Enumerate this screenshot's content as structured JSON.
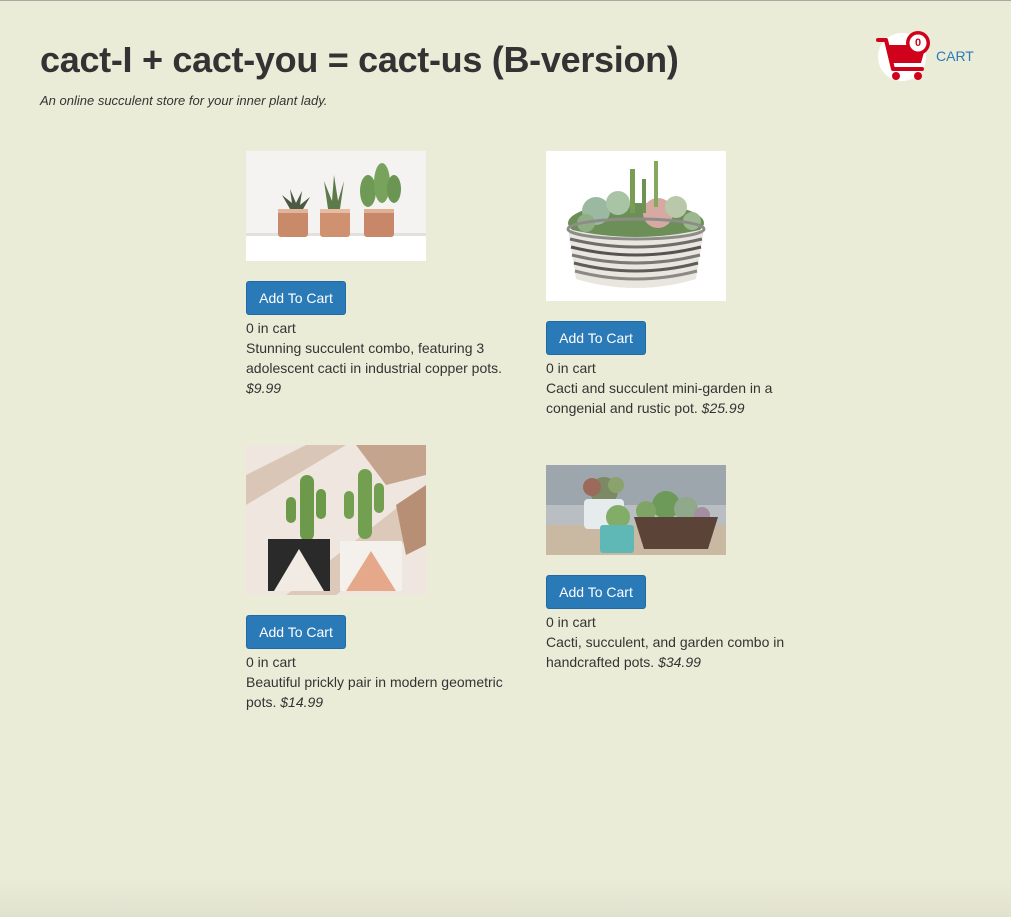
{
  "header": {
    "title": "cact-I + cact-you = cact-us (B-version)",
    "subtitle": "An online succulent store for your inner plant lady."
  },
  "cart": {
    "count": "0",
    "label": "CART",
    "icon": "shopping-cart-icon",
    "color": "#d0021b"
  },
  "products": [
    {
      "image": "three-copper-pots-image",
      "button_label": "Add To Cart",
      "in_cart": "0 in cart",
      "description": "Stunning succulent combo, featuring 3 adolescent cacti in industrial copper pots.",
      "price": "$9.99"
    },
    {
      "image": "mini-garden-bowl-image",
      "button_label": "Add To Cart",
      "in_cart": "0 in cart",
      "description": "Cacti and succulent mini-garden in a congenial and rustic pot.",
      "price": "$25.99"
    },
    {
      "image": "geometric-pots-image",
      "button_label": "Add To Cart",
      "in_cart": "0 in cart",
      "description": "Beautiful prickly pair in modern geometric pots.",
      "price": "$14.99"
    },
    {
      "image": "garden-combo-image",
      "button_label": "Add To Cart",
      "in_cart": "0 in cart",
      "description": "Cacti, succulent, and garden combo in handcrafted pots.",
      "price": "$34.99"
    }
  ],
  "colors": {
    "background": "#ebecd8",
    "button": "#2a7ab8",
    "text": "#333333",
    "link": "#2a7ab8"
  }
}
